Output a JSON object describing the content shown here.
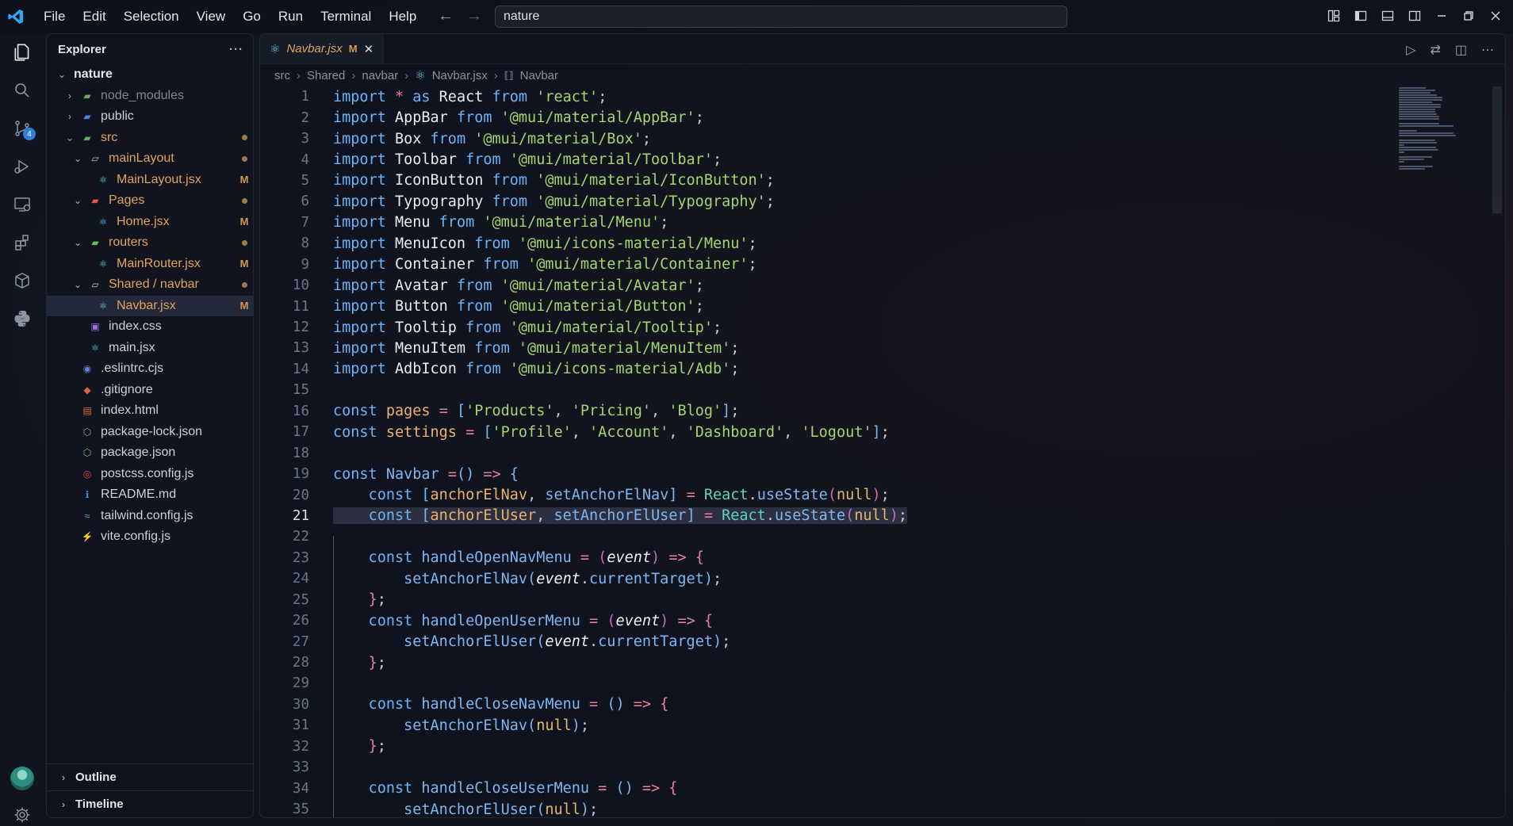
{
  "window": {
    "menu": [
      "File",
      "Edit",
      "Selection",
      "View",
      "Go",
      "Run",
      "Terminal",
      "Help"
    ],
    "search_text": "nature"
  },
  "activitybar": {
    "items": [
      "explorer-icon",
      "search-icon",
      "source-control-icon",
      "run-debug-icon",
      "remote-explorer-icon",
      "extensions-icon",
      "containers-icon",
      "python-icon"
    ],
    "source_control_badge": "4",
    "bottom": [
      "account-avatar-icon",
      "settings-gear-icon"
    ]
  },
  "explorer": {
    "title": "Explorer",
    "more": "···",
    "root": "nature",
    "items": [
      {
        "label": "node_modules",
        "indent": 1,
        "chevron": "›",
        "icon": "folder-node",
        "color": "dim"
      },
      {
        "label": "public",
        "indent": 1,
        "chevron": "›",
        "icon": "folder-public",
        "color": "norm"
      },
      {
        "label": "src",
        "indent": 1,
        "chevron": "⌄",
        "icon": "folder-src",
        "color": "mod",
        "dot": true
      },
      {
        "label": "mainLayout",
        "indent": 2,
        "chevron": "⌄",
        "icon": "folder-open",
        "color": "mod",
        "dot": true
      },
      {
        "label": "MainLayout.jsx",
        "indent": 3,
        "icon": "react",
        "color": "mod",
        "mark": "M"
      },
      {
        "label": "Pages",
        "indent": 2,
        "chevron": "⌄",
        "icon": "folder-pages",
        "color": "mod",
        "dot": true
      },
      {
        "label": "Home.jsx",
        "indent": 3,
        "icon": "react",
        "color": "mod",
        "mark": "M"
      },
      {
        "label": "routers",
        "indent": 2,
        "chevron": "⌄",
        "icon": "folder-routers",
        "color": "mod",
        "dot": true
      },
      {
        "label": "MainRouter.jsx",
        "indent": 3,
        "icon": "react",
        "color": "mod",
        "mark": "M"
      },
      {
        "label": "Shared / navbar",
        "indent": 2,
        "chevron": "⌄",
        "icon": "folder-open",
        "color": "mod",
        "dot": true
      },
      {
        "label": "Navbar.jsx",
        "indent": 3,
        "icon": "react",
        "color": "mod",
        "mark": "M",
        "selected": true
      },
      {
        "label": "index.css",
        "indent": 2,
        "icon": "css",
        "color": "norm"
      },
      {
        "label": "main.jsx",
        "indent": 2,
        "icon": "react",
        "color": "norm"
      },
      {
        "label": ".eslintrc.cjs",
        "indent": 1,
        "icon": "eslint",
        "color": "norm"
      },
      {
        "label": ".gitignore",
        "indent": 1,
        "icon": "git",
        "color": "norm"
      },
      {
        "label": "index.html",
        "indent": 1,
        "icon": "html",
        "color": "norm"
      },
      {
        "label": "package-lock.json",
        "indent": 1,
        "icon": "node",
        "color": "norm"
      },
      {
        "label": "package.json",
        "indent": 1,
        "icon": "node",
        "color": "norm"
      },
      {
        "label": "postcss.config.js",
        "indent": 1,
        "icon": "postcss",
        "color": "norm"
      },
      {
        "label": "README.md",
        "indent": 1,
        "icon": "info",
        "color": "norm"
      },
      {
        "label": "tailwind.config.js",
        "indent": 1,
        "icon": "tailwind",
        "color": "norm"
      },
      {
        "label": "vite.config.js",
        "indent": 1,
        "icon": "vite",
        "color": "norm"
      }
    ],
    "outline": "Outline",
    "timeline": "Timeline"
  },
  "editor": {
    "tab": {
      "name": "Navbar.jsx",
      "mark": "M"
    },
    "breadcrumb": [
      "src",
      "Shared",
      "navbar",
      "Navbar.jsx",
      "Navbar"
    ],
    "current_line": 21,
    "lines": [
      [
        [
          "kw",
          "import"
        ],
        [
          "pn",
          " "
        ],
        [
          "kw2",
          "*"
        ],
        [
          "pn",
          " "
        ],
        [
          "kw",
          "as"
        ],
        [
          "pn",
          " "
        ],
        [
          "id",
          "React"
        ],
        [
          "pn",
          " "
        ],
        [
          "kw",
          "from"
        ],
        [
          "pn",
          " "
        ],
        [
          "str",
          "'react'"
        ],
        [
          "pn",
          ";"
        ]
      ],
      [
        [
          "kw",
          "import"
        ],
        [
          "pn",
          " "
        ],
        [
          "id",
          "AppBar"
        ],
        [
          "pn",
          " "
        ],
        [
          "kw",
          "from"
        ],
        [
          "pn",
          " "
        ],
        [
          "str",
          "'@mui/material/AppBar'"
        ],
        [
          "pn",
          ";"
        ]
      ],
      [
        [
          "kw",
          "import"
        ],
        [
          "pn",
          " "
        ],
        [
          "id",
          "Box"
        ],
        [
          "pn",
          " "
        ],
        [
          "kw",
          "from"
        ],
        [
          "pn",
          " "
        ],
        [
          "str",
          "'@mui/material/Box'"
        ],
        [
          "pn",
          ";"
        ]
      ],
      [
        [
          "kw",
          "import"
        ],
        [
          "pn",
          " "
        ],
        [
          "id",
          "Toolbar"
        ],
        [
          "pn",
          " "
        ],
        [
          "kw",
          "from"
        ],
        [
          "pn",
          " "
        ],
        [
          "str",
          "'@mui/material/Toolbar'"
        ],
        [
          "pn",
          ";"
        ]
      ],
      [
        [
          "kw",
          "import"
        ],
        [
          "pn",
          " "
        ],
        [
          "id",
          "IconButton"
        ],
        [
          "pn",
          " "
        ],
        [
          "kw",
          "from"
        ],
        [
          "pn",
          " "
        ],
        [
          "str",
          "'@mui/material/IconButton'"
        ],
        [
          "pn",
          ";"
        ]
      ],
      [
        [
          "kw",
          "import"
        ],
        [
          "pn",
          " "
        ],
        [
          "id",
          "Typography"
        ],
        [
          "pn",
          " "
        ],
        [
          "kw",
          "from"
        ],
        [
          "pn",
          " "
        ],
        [
          "str",
          "'@mui/material/Typography'"
        ],
        [
          "pn",
          ";"
        ]
      ],
      [
        [
          "kw",
          "import"
        ],
        [
          "pn",
          " "
        ],
        [
          "id",
          "Menu"
        ],
        [
          "pn",
          " "
        ],
        [
          "kw",
          "from"
        ],
        [
          "pn",
          " "
        ],
        [
          "str",
          "'@mui/material/Menu'"
        ],
        [
          "pn",
          ";"
        ]
      ],
      [
        [
          "kw",
          "import"
        ],
        [
          "pn",
          " "
        ],
        [
          "id",
          "MenuIcon"
        ],
        [
          "pn",
          " "
        ],
        [
          "kw",
          "from"
        ],
        [
          "pn",
          " "
        ],
        [
          "str",
          "'@mui/icons-material/Menu'"
        ],
        [
          "pn",
          ";"
        ]
      ],
      [
        [
          "kw",
          "import"
        ],
        [
          "pn",
          " "
        ],
        [
          "id",
          "Container"
        ],
        [
          "pn",
          " "
        ],
        [
          "kw",
          "from"
        ],
        [
          "pn",
          " "
        ],
        [
          "str",
          "'@mui/material/Container'"
        ],
        [
          "pn",
          ";"
        ]
      ],
      [
        [
          "kw",
          "import"
        ],
        [
          "pn",
          " "
        ],
        [
          "id",
          "Avatar"
        ],
        [
          "pn",
          " "
        ],
        [
          "kw",
          "from"
        ],
        [
          "pn",
          " "
        ],
        [
          "str",
          "'@mui/material/Avatar'"
        ],
        [
          "pn",
          ";"
        ]
      ],
      [
        [
          "kw",
          "import"
        ],
        [
          "pn",
          " "
        ],
        [
          "id",
          "Button"
        ],
        [
          "pn",
          " "
        ],
        [
          "kw",
          "from"
        ],
        [
          "pn",
          " "
        ],
        [
          "str",
          "'@mui/material/Button'"
        ],
        [
          "pn",
          ";"
        ]
      ],
      [
        [
          "kw",
          "import"
        ],
        [
          "pn",
          " "
        ],
        [
          "id",
          "Tooltip"
        ],
        [
          "pn",
          " "
        ],
        [
          "kw",
          "from"
        ],
        [
          "pn",
          " "
        ],
        [
          "str",
          "'@mui/material/Tooltip'"
        ],
        [
          "pn",
          ";"
        ]
      ],
      [
        [
          "kw",
          "import"
        ],
        [
          "pn",
          " "
        ],
        [
          "id",
          "MenuItem"
        ],
        [
          "pn",
          " "
        ],
        [
          "kw",
          "from"
        ],
        [
          "pn",
          " "
        ],
        [
          "str",
          "'@mui/material/MenuItem'"
        ],
        [
          "pn",
          ";"
        ]
      ],
      [
        [
          "kw",
          "import"
        ],
        [
          "pn",
          " "
        ],
        [
          "id",
          "AdbIcon"
        ],
        [
          "pn",
          " "
        ],
        [
          "kw",
          "from"
        ],
        [
          "pn",
          " "
        ],
        [
          "str",
          "'@mui/icons-material/Adb'"
        ],
        [
          "pn",
          ";"
        ]
      ],
      [],
      [
        [
          "kw",
          "const"
        ],
        [
          "pn",
          " "
        ],
        [
          "var",
          "pages"
        ],
        [
          "pn",
          " "
        ],
        [
          "op",
          "="
        ],
        [
          "pn",
          " "
        ],
        [
          "fn",
          "["
        ],
        [
          "str",
          "'Products'"
        ],
        [
          "pn",
          ", "
        ],
        [
          "str",
          "'Pricing'"
        ],
        [
          "pn",
          ", "
        ],
        [
          "str",
          "'Blog'"
        ],
        [
          "fn",
          "]"
        ],
        [
          "pn",
          ";"
        ]
      ],
      [
        [
          "kw",
          "const"
        ],
        [
          "pn",
          " "
        ],
        [
          "var",
          "settings"
        ],
        [
          "pn",
          " "
        ],
        [
          "op",
          "="
        ],
        [
          "pn",
          " "
        ],
        [
          "fn",
          "["
        ],
        [
          "str",
          "'Profile'"
        ],
        [
          "pn",
          ", "
        ],
        [
          "str",
          "'Account'"
        ],
        [
          "pn",
          ", "
        ],
        [
          "str",
          "'Dashboard'"
        ],
        [
          "pn",
          ", "
        ],
        [
          "str",
          "'Logout'"
        ],
        [
          "fn",
          "]"
        ],
        [
          "pn",
          ";"
        ]
      ],
      [],
      [
        [
          "kw",
          "const"
        ],
        [
          "pn",
          " "
        ],
        [
          "fn",
          "Navbar"
        ],
        [
          "pn",
          " "
        ],
        [
          "op",
          "="
        ],
        [
          "fn",
          "()"
        ],
        [
          "pn",
          " "
        ],
        [
          "op",
          "=>"
        ],
        [
          "pn",
          " "
        ],
        [
          "fn",
          "{"
        ]
      ],
      [
        [
          "pn",
          "    "
        ],
        [
          "kw",
          "const"
        ],
        [
          "pn",
          " "
        ],
        [
          "fn",
          "["
        ],
        [
          "var",
          "anchorElNav"
        ],
        [
          "pn",
          ", "
        ],
        [
          "fn",
          "setAnchorElNav"
        ],
        [
          "fn",
          "]"
        ],
        [
          "pn",
          " "
        ],
        [
          "op",
          "="
        ],
        [
          "pn",
          " "
        ],
        [
          "cls",
          "React"
        ],
        [
          "pn",
          "."
        ],
        [
          "fn",
          "useState"
        ],
        [
          "br",
          "("
        ],
        [
          "nl",
          "null"
        ],
        [
          "br",
          ")"
        ],
        [
          "pn",
          ";"
        ]
      ],
      [
        [
          "pn",
          "    "
        ],
        [
          "kw",
          "const"
        ],
        [
          "pn",
          " "
        ],
        [
          "fn",
          "["
        ],
        [
          "var",
          "anchorElUser"
        ],
        [
          "pn",
          ", "
        ],
        [
          "fn",
          "setAnchorElUser"
        ],
        [
          "fn",
          "]"
        ],
        [
          "pn",
          " "
        ],
        [
          "op",
          "="
        ],
        [
          "pn",
          " "
        ],
        [
          "cls",
          "React"
        ],
        [
          "pn",
          "."
        ],
        [
          "fn",
          "useState"
        ],
        [
          "br",
          "("
        ],
        [
          "nl",
          "null"
        ],
        [
          "br",
          ")"
        ],
        [
          "pn",
          ";"
        ]
      ],
      [],
      [
        [
          "pn",
          "    "
        ],
        [
          "kw",
          "const"
        ],
        [
          "pn",
          " "
        ],
        [
          "fn",
          "handleOpenNavMenu"
        ],
        [
          "pn",
          " "
        ],
        [
          "op",
          "="
        ],
        [
          "pn",
          " "
        ],
        [
          "br",
          "("
        ],
        [
          "it",
          "event"
        ],
        [
          "br",
          ")"
        ],
        [
          "pn",
          " "
        ],
        [
          "op",
          "=>"
        ],
        [
          "pn",
          " "
        ],
        [
          "op",
          "{"
        ]
      ],
      [
        [
          "pn",
          "        "
        ],
        [
          "fn",
          "setAnchorElNav"
        ],
        [
          "fn",
          "("
        ],
        [
          "it",
          "event"
        ],
        [
          "pn",
          "."
        ],
        [
          "fn",
          "currentTarget"
        ],
        [
          "fn",
          ")"
        ],
        [
          "pn",
          ";"
        ]
      ],
      [
        [
          "pn",
          "    "
        ],
        [
          "op",
          "}"
        ],
        [
          "pn",
          ";"
        ]
      ],
      [
        [
          "pn",
          "    "
        ],
        [
          "kw",
          "const"
        ],
        [
          "pn",
          " "
        ],
        [
          "fn",
          "handleOpenUserMenu"
        ],
        [
          "pn",
          " "
        ],
        [
          "op",
          "="
        ],
        [
          "pn",
          " "
        ],
        [
          "br",
          "("
        ],
        [
          "it",
          "event"
        ],
        [
          "br",
          ")"
        ],
        [
          "pn",
          " "
        ],
        [
          "op",
          "=>"
        ],
        [
          "pn",
          " "
        ],
        [
          "op",
          "{"
        ]
      ],
      [
        [
          "pn",
          "        "
        ],
        [
          "fn",
          "setAnchorElUser"
        ],
        [
          "fn",
          "("
        ],
        [
          "it",
          "event"
        ],
        [
          "pn",
          "."
        ],
        [
          "fn",
          "currentTarget"
        ],
        [
          "fn",
          ")"
        ],
        [
          "pn",
          ";"
        ]
      ],
      [
        [
          "pn",
          "    "
        ],
        [
          "op",
          "}"
        ],
        [
          "pn",
          ";"
        ]
      ],
      [],
      [
        [
          "pn",
          "    "
        ],
        [
          "kw",
          "const"
        ],
        [
          "pn",
          " "
        ],
        [
          "fn",
          "handleCloseNavMenu"
        ],
        [
          "pn",
          " "
        ],
        [
          "op",
          "="
        ],
        [
          "pn",
          " "
        ],
        [
          "fn",
          "()"
        ],
        [
          "pn",
          " "
        ],
        [
          "op",
          "=>"
        ],
        [
          "pn",
          " "
        ],
        [
          "op",
          "{"
        ]
      ],
      [
        [
          "pn",
          "        "
        ],
        [
          "fn",
          "setAnchorElNav"
        ],
        [
          "fn",
          "("
        ],
        [
          "nl",
          "null"
        ],
        [
          "fn",
          ")"
        ],
        [
          "pn",
          ";"
        ]
      ],
      [
        [
          "pn",
          "    "
        ],
        [
          "op",
          "}"
        ],
        [
          "pn",
          ";"
        ]
      ],
      [],
      [
        [
          "pn",
          "    "
        ],
        [
          "kw",
          "const"
        ],
        [
          "pn",
          " "
        ],
        [
          "fn",
          "handleCloseUserMenu"
        ],
        [
          "pn",
          " "
        ],
        [
          "op",
          "="
        ],
        [
          "pn",
          " "
        ],
        [
          "fn",
          "()"
        ],
        [
          "pn",
          " "
        ],
        [
          "op",
          "=>"
        ],
        [
          "pn",
          " "
        ],
        [
          "op",
          "{"
        ]
      ],
      [
        [
          "pn",
          "        "
        ],
        [
          "fn",
          "setAnchorElUser"
        ],
        [
          "fn",
          "("
        ],
        [
          "nl",
          "null"
        ],
        [
          "fn",
          ")"
        ],
        [
          "pn",
          ";"
        ]
      ]
    ]
  },
  "colors": {
    "accent": "#2f7fd9",
    "modified": "#e2a35a",
    "keyword": "#6db3f5",
    "string": "#a6d46e"
  }
}
